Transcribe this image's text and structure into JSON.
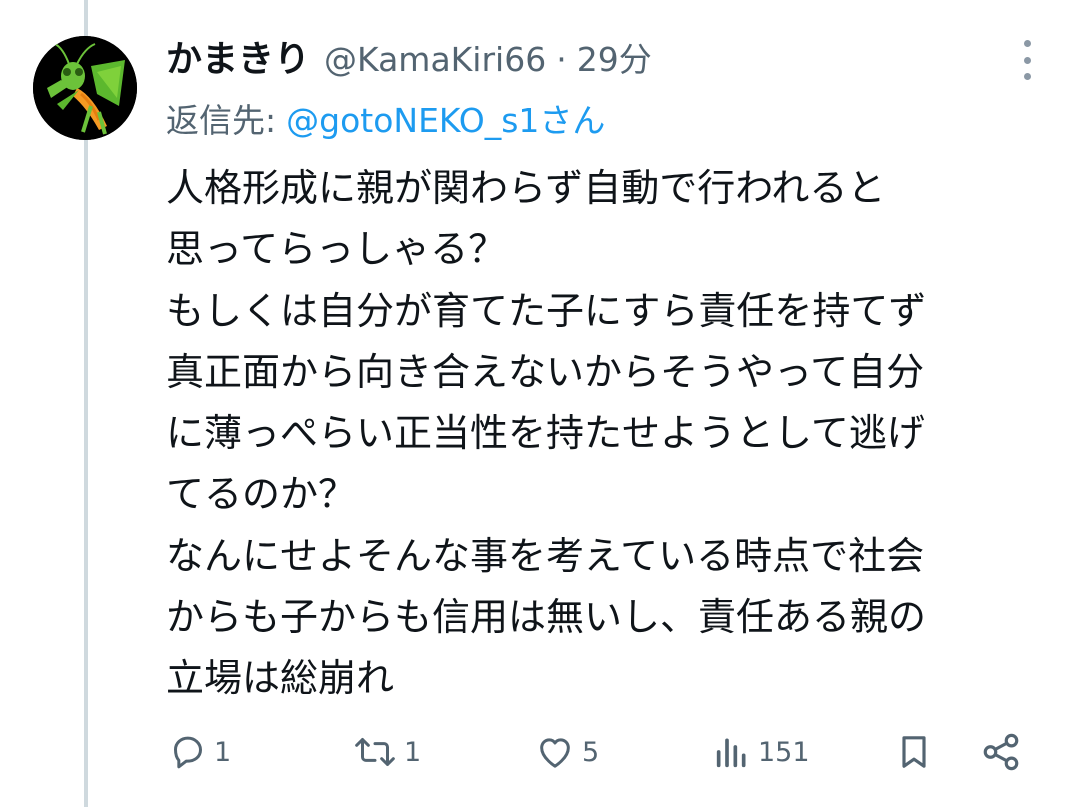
{
  "tweet": {
    "display_name": "かまきり",
    "handle": "@KamaKiri66",
    "separator": "·",
    "time": "29分",
    "reply_to_label": "返信先:",
    "reply_to_mention": "@gotoNEKO_s1さん",
    "body_lines": [
      "人格形成に親が関わらず自動で行われると",
      "思ってらっしゃる？",
      "もしくは自分が育てた子にすら責任を持てず",
      "真正面から向き合えないからそうやって自分",
      "に薄っぺらい正当性を持たせようとして逃げ",
      "てるのか？",
      "なんにせよそんな事を考えている時点で社会",
      "からも子からも信用は無いし、責任ある親の",
      "立場は総崩れ"
    ]
  },
  "actions": {
    "reply_count": "1",
    "retweet_count": "1",
    "like_count": "5",
    "view_count": "151"
  },
  "icons": {
    "avatar": "praying-mantis-avatar",
    "more": "more-vertical-icon",
    "reply": "reply-icon",
    "retweet": "retweet-icon",
    "like": "heart-icon",
    "views": "views-icon",
    "bookmark": "bookmark-icon",
    "share": "share-icon"
  },
  "colors": {
    "text": "#0f1419",
    "secondary": "#536471",
    "link": "#1d9bf0"
  }
}
